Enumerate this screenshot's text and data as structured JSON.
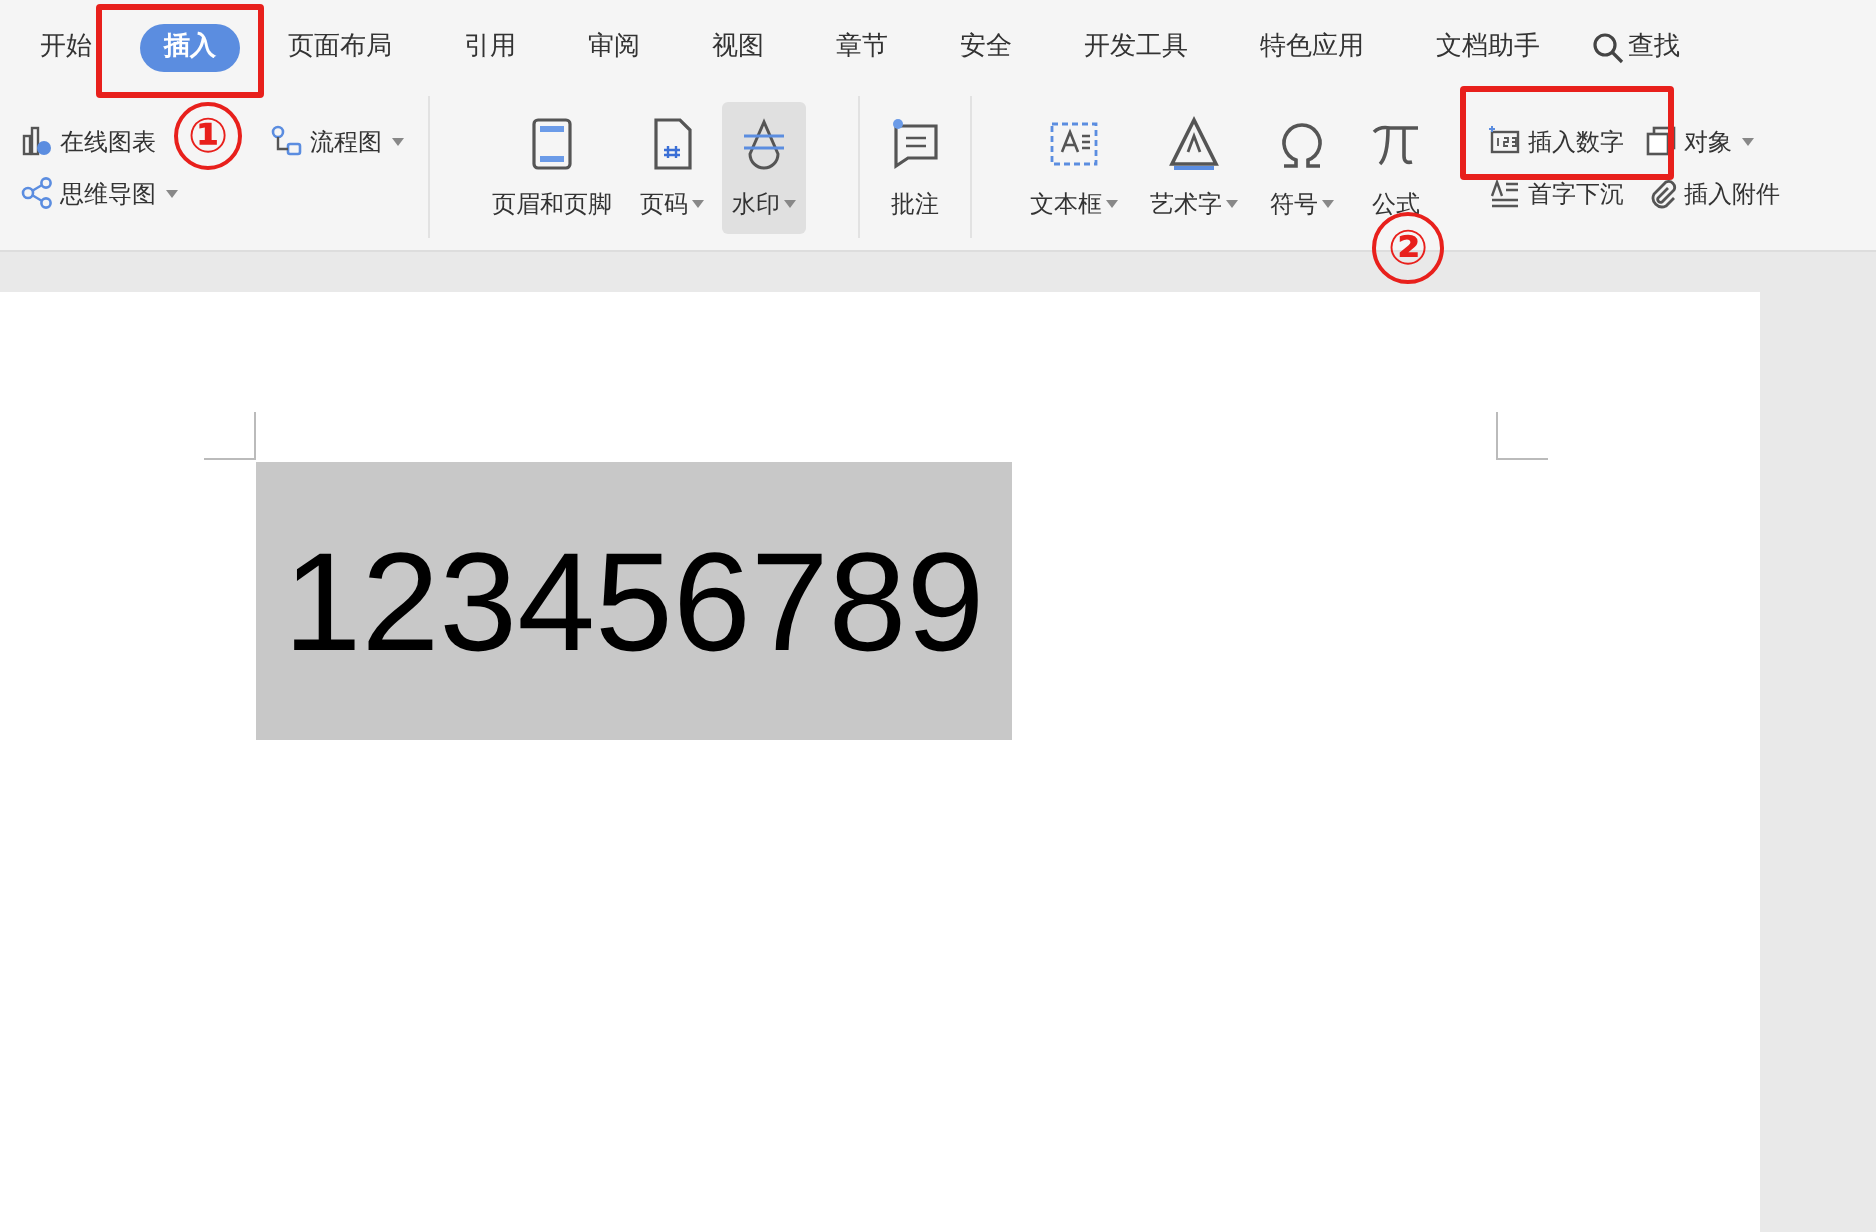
{
  "tabs": [
    {
      "label": "开始",
      "selected": false
    },
    {
      "label": "插入",
      "selected": true
    },
    {
      "label": "页面布局",
      "selected": false
    },
    {
      "label": "引用",
      "selected": false
    },
    {
      "label": "审阅",
      "selected": false
    },
    {
      "label": "视图",
      "selected": false
    },
    {
      "label": "章节",
      "selected": false
    },
    {
      "label": "安全",
      "selected": false
    },
    {
      "label": "开发工具",
      "selected": false
    },
    {
      "label": "特色应用",
      "selected": false
    },
    {
      "label": "文档助手",
      "selected": false
    }
  ],
  "search": {
    "label": "查找"
  },
  "ribbon": [
    {
      "kind": "small",
      "items": [
        {
          "label": "在线图表",
          "dropdown": false
        },
        {
          "label": "思维导图",
          "dropdown": true
        },
        {
          "label": "流程图",
          "dropdown": true
        }
      ]
    },
    {
      "kind": "large",
      "items": [
        {
          "label": "页眉和页脚",
          "dropdown": false,
          "highlighted": false
        },
        {
          "label": "页码",
          "dropdown": true,
          "highlighted": false
        },
        {
          "label": "水印",
          "dropdown": true,
          "highlighted": true
        }
      ]
    },
    {
      "kind": "large",
      "items": [
        {
          "label": "批注",
          "dropdown": false,
          "highlighted": false
        }
      ]
    },
    {
      "kind": "large",
      "items": [
        {
          "label": "文本框",
          "dropdown": true,
          "highlighted": false
        },
        {
          "label": "艺术字",
          "dropdown": true,
          "highlighted": false
        },
        {
          "label": "符号",
          "dropdown": true,
          "highlighted": false
        },
        {
          "label": "公式",
          "dropdown": false,
          "highlighted": false
        }
      ]
    },
    {
      "kind": "small",
      "items": [
        {
          "label": "插入数字",
          "dropdown": false
        },
        {
          "label": "首字下沉",
          "dropdown": false
        },
        {
          "label": "对象",
          "dropdown": true
        },
        {
          "label": "插入附件",
          "dropdown": false
        }
      ]
    }
  ],
  "annotations": [
    {
      "label": "①"
    },
    {
      "label": "②"
    }
  ],
  "document": {
    "text": "123456789"
  }
}
